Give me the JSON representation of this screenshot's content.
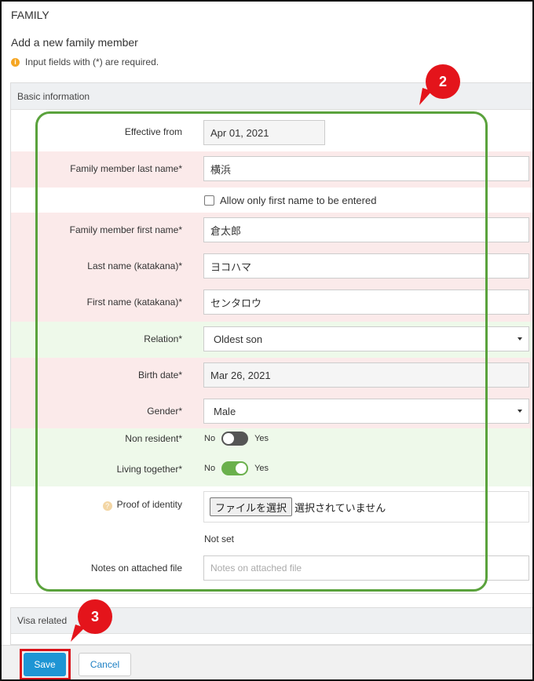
{
  "page": {
    "title": "FAMILY",
    "subtitle": "Add a new family member",
    "required_notice": "Input fields with (*) are required."
  },
  "basic_info": {
    "header": "Basic information",
    "effective_from": {
      "label": "Effective from",
      "value": "Apr 01, 2021"
    },
    "last_name": {
      "label": "Family member last name*",
      "value": "横浜"
    },
    "first_name_only": {
      "label": "Allow only first name to be entered",
      "checked": false
    },
    "first_name": {
      "label": "Family member first name*",
      "value": "倉太郎"
    },
    "last_name_kana": {
      "label": "Last name (katakana)*",
      "value": "ヨコハマ"
    },
    "first_name_kana": {
      "label": "First name (katakana)*",
      "value": "センタロウ"
    },
    "relation": {
      "label": "Relation*",
      "value": "Oldest son"
    },
    "birth_date": {
      "label": "Birth date*",
      "value": "Mar 26, 2021"
    },
    "gender": {
      "label": "Gender*",
      "value": "Male"
    },
    "non_resident": {
      "label": "Non resident*",
      "no": "No",
      "yes": "Yes",
      "on": false
    },
    "living_together": {
      "label": "Living together*",
      "no": "No",
      "yes": "Yes",
      "on": true
    },
    "proof_of_identity": {
      "label": "Proof of identity",
      "button": "ファイルを選択",
      "status": "選択されていません",
      "help_icon": "question-icon",
      "current": "Not set"
    },
    "notes_on_attached_file": {
      "label": "Notes on attached file",
      "placeholder": "Notes on attached file"
    }
  },
  "visa": {
    "header": "Visa related"
  },
  "footer": {
    "save": "Save",
    "cancel": "Cancel"
  },
  "annotations": {
    "callout_2": "2",
    "callout_3": "3"
  },
  "colors": {
    "required_row": "#fbeaea",
    "boolean_row": "#eef9ea",
    "primary": "#1e95d4",
    "toggle_on": "#6ab04c",
    "annotation_green": "#5aa23c",
    "annotation_red": "#e4141b"
  }
}
